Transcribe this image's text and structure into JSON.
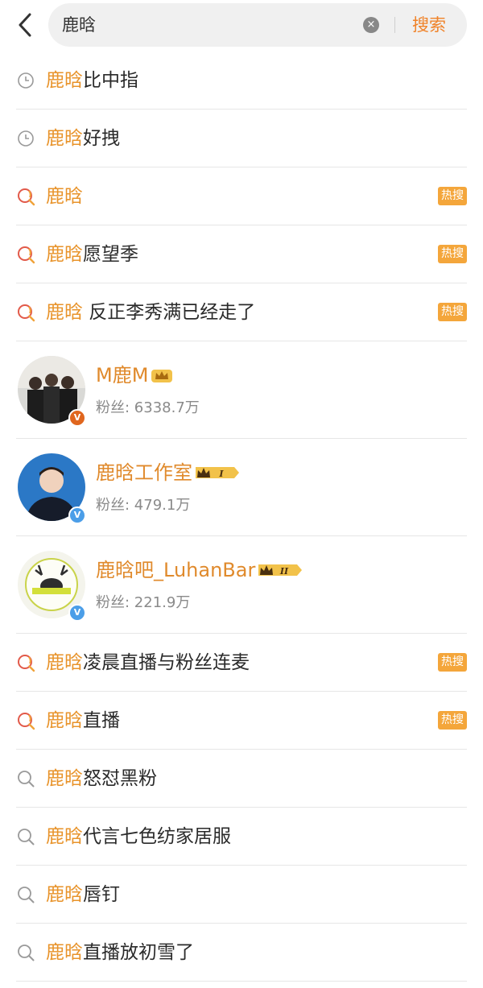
{
  "header": {
    "search_value": "鹿晗",
    "search_button": "搜索",
    "clear_glyph": "×"
  },
  "list": [
    {
      "kind": "history",
      "highlight": "鹿晗",
      "rest": "比中指",
      "hot": false
    },
    {
      "kind": "history",
      "highlight": "鹿晗",
      "rest": "好拽",
      "hot": false
    },
    {
      "kind": "hot",
      "highlight": "鹿晗",
      "rest": "",
      "hot": true
    },
    {
      "kind": "hot",
      "highlight": "鹿晗",
      "rest": "愿望季",
      "hot": true
    },
    {
      "kind": "hot",
      "highlight": "鹿晗",
      "rest": " 反正李秀满已经走了",
      "hot": true
    }
  ],
  "users": [
    {
      "name": "M鹿M",
      "fans": "粉丝: 6338.7万",
      "verified": "orange",
      "crown": "gold"
    },
    {
      "name": "鹿晗工作室",
      "fans": "粉丝: 479.1万",
      "verified": "blue",
      "crown": "I"
    },
    {
      "name": "鹿晗吧_LuhanBar",
      "fans": "粉丝: 221.9万",
      "verified": "blue",
      "crown": "II"
    }
  ],
  "list2": [
    {
      "kind": "hot",
      "highlight": "鹿晗",
      "rest": "凌晨直播与粉丝连麦",
      "hot": true
    },
    {
      "kind": "hot",
      "highlight": "鹿晗",
      "rest": "直播",
      "hot": true
    },
    {
      "kind": "search",
      "highlight": "鹿晗",
      "rest": "怒怼黑粉",
      "hot": false
    },
    {
      "kind": "search",
      "highlight": "鹿晗",
      "rest": "代言七色纺家居服",
      "hot": false
    },
    {
      "kind": "search",
      "highlight": "鹿晗",
      "rest": "唇钉",
      "hot": false
    },
    {
      "kind": "search",
      "highlight": "鹿晗",
      "rest": "直播放初雪了",
      "hot": false
    }
  ],
  "hot_badge_label": "热搜",
  "verified_glyph": "V",
  "colors": {
    "accent": "#f08228",
    "highlight": "#e8932a",
    "hot_badge": "#f4a63b",
    "verified_blue": "#4b9ee8",
    "verified_orange": "#e0661e"
  },
  "icons": {
    "history": "clock-icon",
    "hot": "hot-search-icon",
    "search": "magnifier-icon",
    "back": "back-chevron-icon"
  }
}
